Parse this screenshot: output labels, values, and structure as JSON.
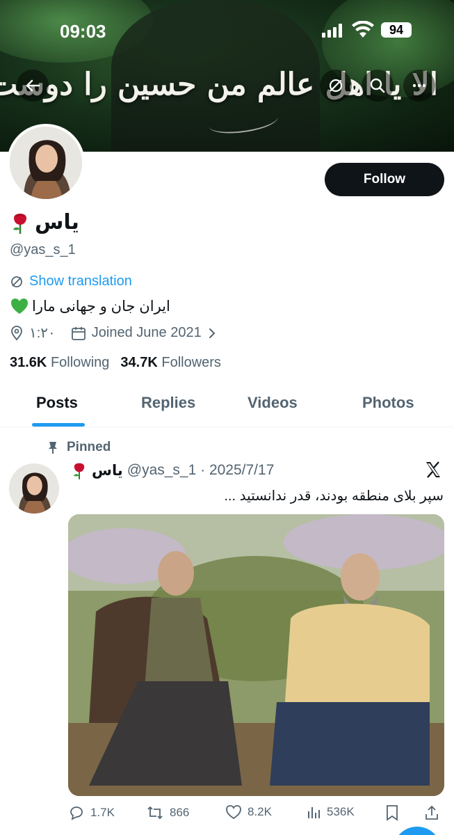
{
  "status_bar": {
    "time": "09:03",
    "battery": "94"
  },
  "banner": {
    "script_text": "الا یا اهل عالم من حسین را دوست دارم"
  },
  "profile": {
    "follow_label": "Follow",
    "name": "یاس",
    "name_emoji": "rose",
    "handle": "@yas_s_1",
    "show_translation": "Show translation",
    "bio": "ایران جان و جهانی مارا",
    "bio_emoji": "green-heart",
    "location": "۱:۲۰",
    "joined": "Joined June 2021",
    "following_count": "31.6K",
    "following_label": "Following",
    "followers_count": "34.7K",
    "followers_label": "Followers"
  },
  "tabs": [
    {
      "label": "Posts",
      "active": true
    },
    {
      "label": "Replies",
      "active": false
    },
    {
      "label": "Videos",
      "active": false
    },
    {
      "label": "Photos",
      "active": false
    }
  ],
  "tweet": {
    "pinned_label": "Pinned",
    "name": "یاس",
    "handle_date": "@yas_s_1 · 2025/7/17",
    "text": "سپر بلای منطقه بودند، قدر ندانستید  ...",
    "replies": "1.7K",
    "reposts": "866",
    "likes": "8.2K",
    "views": "536K"
  },
  "colors": {
    "accent": "#1d9bf0",
    "text": "#0f1419",
    "muted": "#536471",
    "rose": "#c8102e",
    "heart": "#3cb043"
  }
}
